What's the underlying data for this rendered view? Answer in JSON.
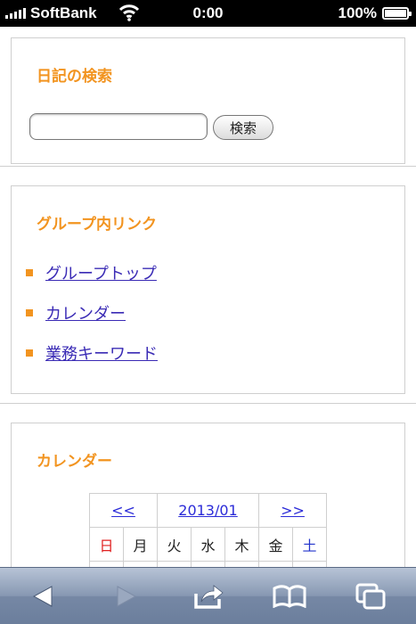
{
  "status_bar": {
    "carrier": "SoftBank",
    "time": "0:00",
    "battery_percent": "100%",
    "battery_level": 1.0
  },
  "diary_search": {
    "title": "日記の検索",
    "input_value": "",
    "button_label": "検索"
  },
  "group_links": {
    "title": "グループ内リンク",
    "items": [
      {
        "label": "グループトップ"
      },
      {
        "label": "カレンダー"
      },
      {
        "label": "業務キーワード"
      }
    ]
  },
  "calendar": {
    "title": "カレンダー",
    "prev_label": "<<",
    "month_label": "2013/01",
    "next_label": ">>",
    "weekdays": [
      "日",
      "月",
      "火",
      "水",
      "木",
      "金",
      "土"
    ]
  },
  "colors": {
    "accent": "#f29420",
    "link": "#3a2bb5",
    "sunday": "#e02020",
    "saturday": "#2233cc"
  },
  "toolbar": {
    "buttons": [
      "back-icon",
      "forward-icon",
      "share-icon",
      "bookmarks-icon",
      "tabs-icon"
    ]
  }
}
